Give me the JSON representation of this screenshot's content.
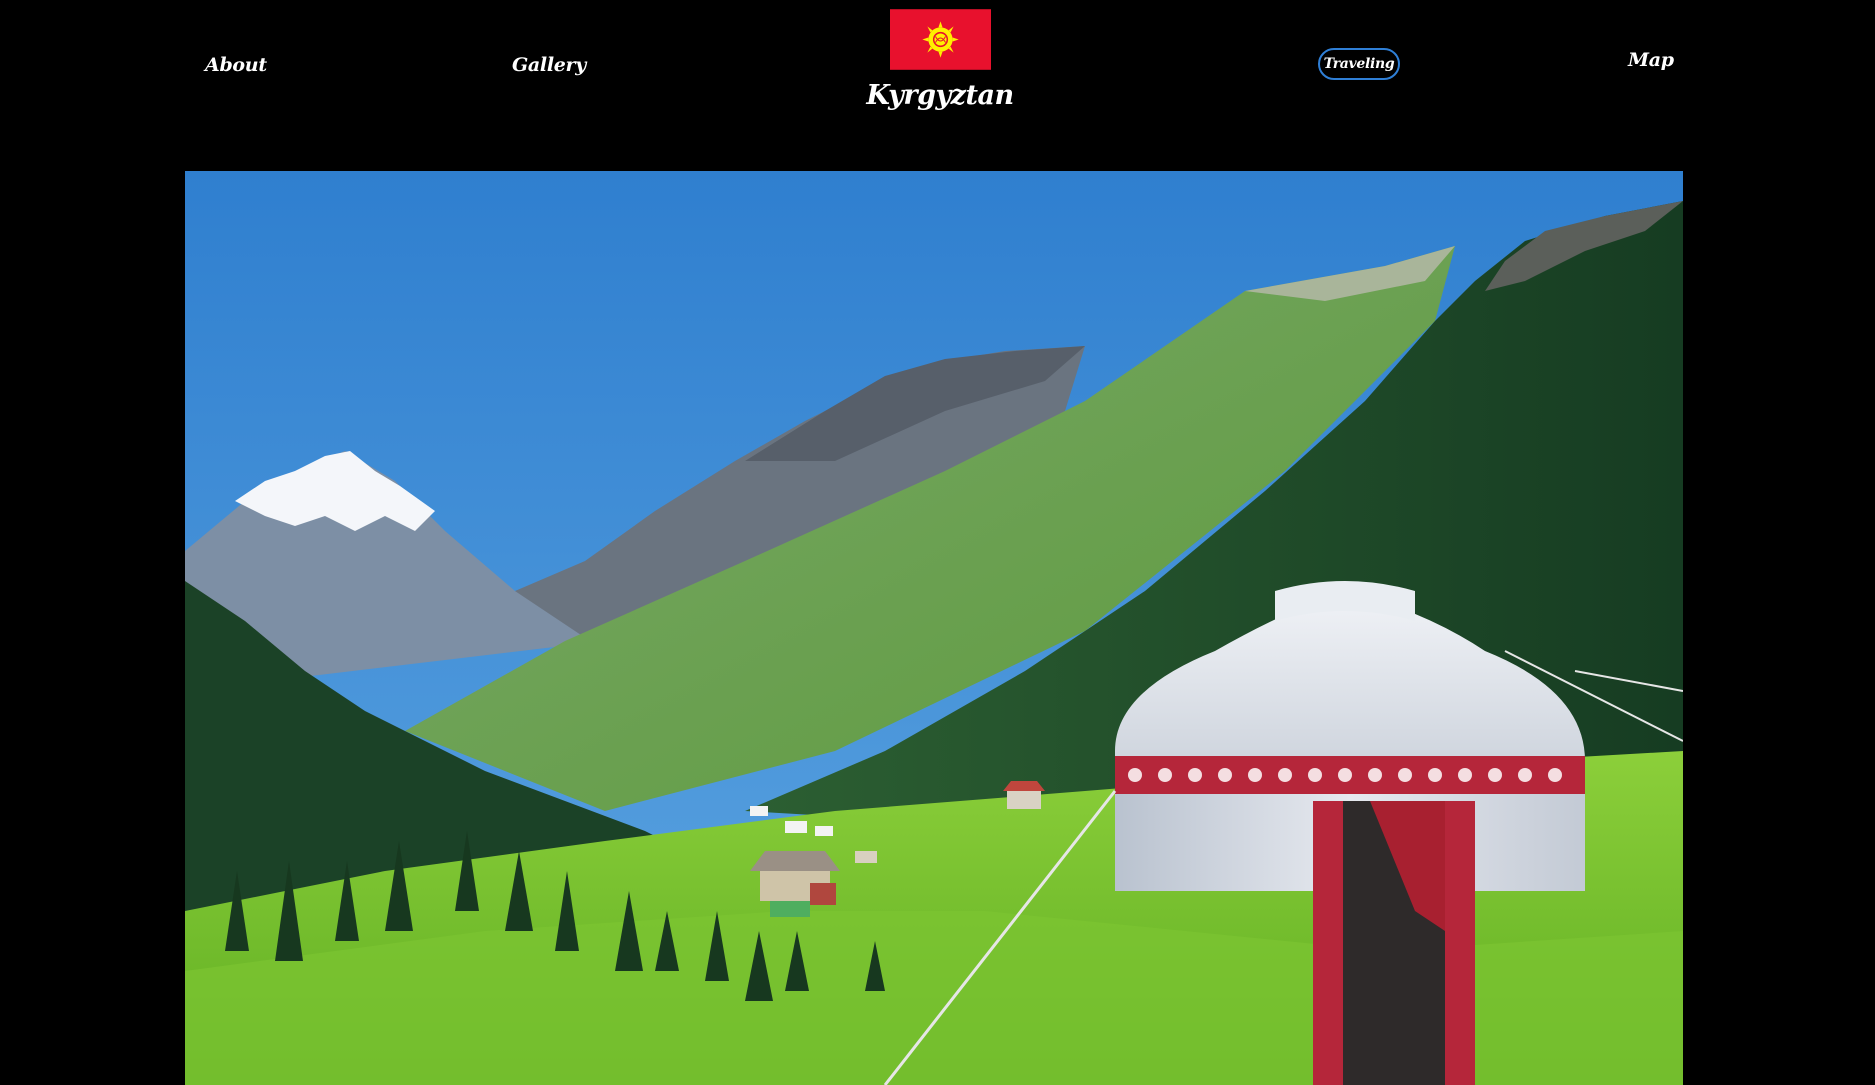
{
  "nav": {
    "about_label": "About",
    "gallery_label": "Gallery",
    "traveling_label": "Traveling",
    "map_label": "Map"
  },
  "brand": {
    "title": "Kyrgyztan",
    "flag_icon": "kyrgyzstan-flag-icon",
    "flag_colors": {
      "field": "#e8112d",
      "sun": "#ffef00"
    }
  },
  "hero": {
    "image_icon": "mountain-valley-yurt-photo",
    "colors": {
      "sky": "#3f8fd8",
      "grass": "#6fbf2e",
      "forest": "#1e4a2a",
      "snow": "#f4f6fa",
      "yurt": "#dfe3ea",
      "pattern": "#b5263a"
    }
  },
  "theme": {
    "background": "#000000",
    "text": "#ffffff",
    "active_border": "#2f7fd6"
  }
}
